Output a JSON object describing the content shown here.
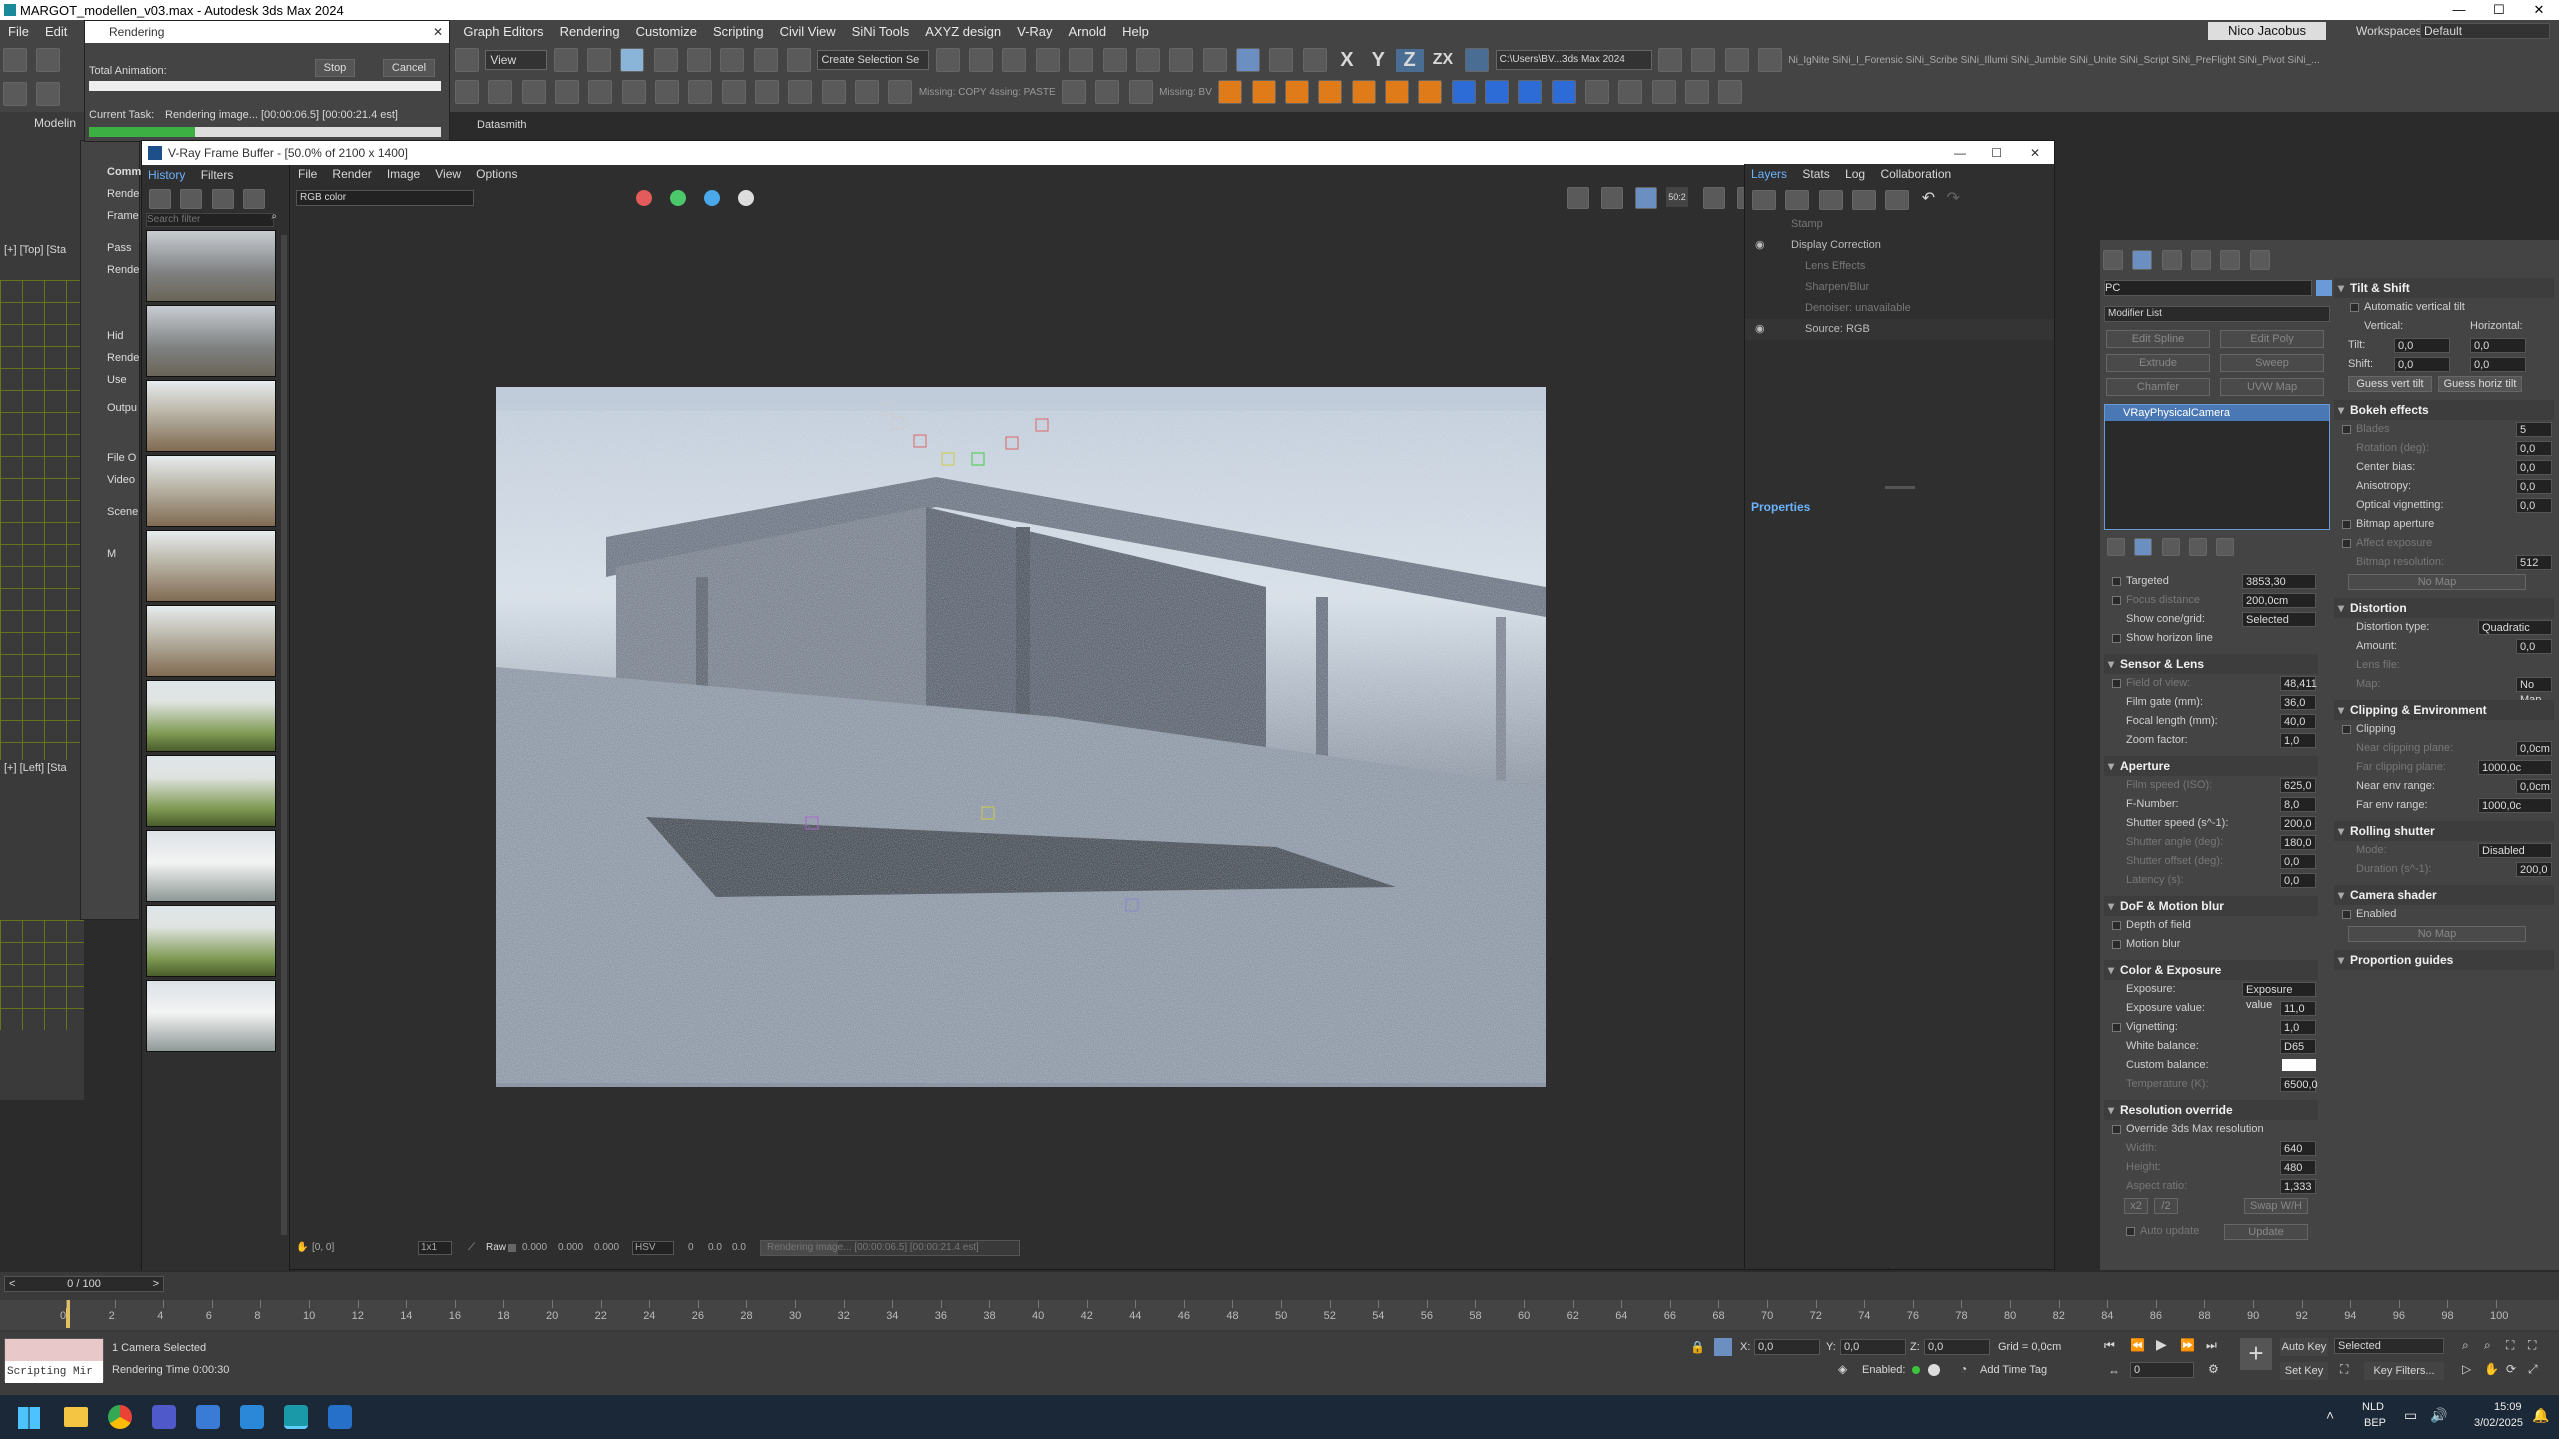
{
  "window": {
    "title": "MARGOT_modellen_v03.max - Autodesk 3ds Max 2024"
  },
  "menu": [
    "File",
    "Edit",
    "Graph Editors",
    "Rendering",
    "Customize",
    "Scripting",
    "Civil View",
    "SiNi Tools",
    "AXYZ design",
    "V-Ray",
    "Arnold",
    "Help"
  ],
  "user": "Nico Jacobus",
  "workspace": {
    "label": "Workspaces:",
    "value": "Default"
  },
  "toolbar": {
    "view_dropdown": "View",
    "create_selection": "Create Selection Se",
    "path": "C:\\Users\\BV...3ds Max 2024",
    "missing_text": "Missing: COPY 4ssing: PASTE",
    "missing_bv": "Missing: BV",
    "sini_items": "Ni_IgNite  SiNi_I_Forensic  SiNi_Scribe  SiNi_Illumi  SiNi_Jumble  SiNi_Unite  SiNi_Script  SiNi_PreFlight  SiNi_Pivot  SiNi_..."
  },
  "rendering_dialog": {
    "title": "Rendering",
    "total_animation": "Total Animation:",
    "stop": "Stop",
    "cancel": "Cancel",
    "current_task_label": "Current Task:",
    "current_task": "Rendering image... [00:00:06.5] [00:00:21.4 est]",
    "datasmith": "Datasmith"
  },
  "viewport_labels": {
    "top": "[+] [Top] [Sta",
    "left": "[+] [Left] [Sta"
  },
  "behind_labels": [
    "Comm",
    "Rende",
    "Frame",
    "Pass",
    "Rende",
    "Hid",
    "Rende",
    "Use",
    "Outpu",
    "File O",
    "Video",
    "Scene",
    "M",
    "Modelin"
  ],
  "vfb": {
    "title": "V-Ray Frame Buffer - [50.0% of 2100 x 1400]",
    "left_tabs": [
      "History",
      "Filters"
    ],
    "menus": [
      "File",
      "Render",
      "Image",
      "View",
      "Options"
    ],
    "search_placeholder": "Search filter",
    "channel": "RGB color",
    "zoom_badge": "50:2",
    "right_tabs": [
      "Layers",
      "Stats",
      "Log",
      "Collaboration"
    ],
    "layers": [
      "Stamp",
      "Display Correction",
      "Lens Effects",
      "Sharpen/Blur",
      "Denoiser: unavailable",
      "Source: RGB"
    ],
    "properties": "Properties",
    "status": {
      "coords": "[0, 0]",
      "ratio": "1x1",
      "raw": "Raw",
      "r": "0.000",
      "g": "0.000",
      "b": "0.000",
      "mode": "HSV",
      "h": "0",
      "s": "0.0",
      "v": "0.0",
      "progress": "Rendering image... [00:00:06.5] [00:00:21.4 est]",
      "progress_fraction": 0.3
    }
  },
  "cmd_panel": {
    "object_name": "PC",
    "modifier_list": "Modifier List",
    "buttons": [
      "Edit Spline",
      "Edit Poly",
      "Extrude",
      "Sweep",
      "Chamfer",
      "UVW Map"
    ],
    "stack_item": "VRayPhysicalCamera"
  },
  "cam_left": {
    "top_rows": [
      {
        "label": "Targeted",
        "value": "3853,30",
        "check": true
      },
      {
        "label": "Focus distance",
        "value": "200,0cm",
        "check": true,
        "dis": true
      },
      {
        "label": "Show cone/grid:",
        "value": "Selected",
        "check": false
      },
      {
        "label": "Show horizon line",
        "value": "",
        "check": true
      }
    ],
    "sensor": {
      "title": "Sensor & Lens",
      "rows": [
        {
          "label": "Field of view:",
          "value": "48,411",
          "check": true,
          "dis": true
        },
        {
          "label": "Film gate (mm):",
          "value": "36,0"
        },
        {
          "label": "Focal length (mm):",
          "value": "40,0"
        },
        {
          "label": "Zoom factor:",
          "value": "1,0"
        }
      ]
    },
    "aperture": {
      "title": "Aperture",
      "rows": [
        {
          "label": "Film speed (ISO):",
          "value": "625,0",
          "dis": true
        },
        {
          "label": "F-Number:",
          "value": "8,0"
        },
        {
          "label": "Shutter speed (s^-1):",
          "value": "200,0"
        },
        {
          "label": "Shutter angle (deg):",
          "value": "180,0",
          "dis": true
        },
        {
          "label": "Shutter offset (deg):",
          "value": "0,0",
          "dis": true
        },
        {
          "label": "Latency (s):",
          "value": "0,0",
          "dis": true
        }
      ]
    },
    "dof": {
      "title": "DoF & Motion blur",
      "rows": [
        {
          "label": "Depth of field",
          "value": "",
          "check": true
        },
        {
          "label": "Motion blur",
          "value": "",
          "check": true
        }
      ]
    },
    "color": {
      "title": "Color & Exposure",
      "rows": [
        {
          "label": "Exposure:",
          "value": "Exposure value"
        },
        {
          "label": "Exposure value:",
          "value": "11,0"
        },
        {
          "label": "Vignetting:",
          "value": "1,0",
          "check": true
        },
        {
          "label": "White balance:",
          "value": "D65"
        },
        {
          "label": "Custom balance:",
          "value": ""
        },
        {
          "label": "Temperature (K):",
          "value": "6500,0",
          "dis": true
        }
      ]
    },
    "resolution": {
      "title": "Resolution override",
      "rows": [
        {
          "label": "Override 3ds Max resolution",
          "value": "",
          "check": true
        },
        {
          "label": "Width:",
          "value": "640",
          "dis": true
        },
        {
          "label": "Height:",
          "value": "480",
          "dis": true
        },
        {
          "label": "Aspect ratio:",
          "value": "1,333",
          "dis": true
        }
      ],
      "buttons": [
        "x2",
        "/2",
        "Swap W/H"
      ],
      "auto_update": "Auto update",
      "update": "Update"
    }
  },
  "cam_right": {
    "tilt": {
      "title": "Tilt & Shift",
      "auto": "Automatic vertical tilt",
      "vertical": "Vertical:",
      "horizontal": "Horizontal:",
      "tilt_label": "Tilt:",
      "tilt_v": "0,0",
      "tilt_h": "0,0",
      "shift_label": "Shift:",
      "shift_v": "0,0",
      "shift_h": "0,0",
      "guess_vert": "Guess vert tilt",
      "guess_horiz": "Guess horiz tilt"
    },
    "bokeh": {
      "title": "Bokeh effects",
      "rows": [
        {
          "label": "Blades",
          "value": "5",
          "check": true,
          "dis": true
        },
        {
          "label": "Rotation (deg):",
          "value": "0,0",
          "dis": true
        },
        {
          "label": "Center bias:",
          "value": "0,0"
        },
        {
          "label": "Anisotropy:",
          "value": "0,0"
        },
        {
          "label": "Optical vignetting:",
          "value": "0,0"
        },
        {
          "label": "Bitmap aperture",
          "value": "",
          "check": true
        },
        {
          "label": "Affect exposure",
          "value": "",
          "check": true,
          "dis": true
        },
        {
          "label": "Bitmap resolution:",
          "value": "512",
          "dis": true
        }
      ],
      "no_map": "No Map"
    },
    "distortion": {
      "title": "Distortion",
      "rows": [
        {
          "label": "Distortion type:",
          "value": "Quadratic"
        },
        {
          "label": "Amount:",
          "value": "0,0"
        },
        {
          "label": "Lens file:",
          "value": "",
          "dis": true
        },
        {
          "label": "Map:",
          "value": "No Map",
          "dis": true
        }
      ]
    },
    "clipping": {
      "title": "Clipping & Environment",
      "rows": [
        {
          "label": "Clipping",
          "value": "",
          "check": true
        },
        {
          "label": "Near clipping plane:",
          "value": "0,0cm",
          "dis": true
        },
        {
          "label": "Far clipping plane:",
          "value": "1000,0c",
          "dis": true
        },
        {
          "label": "Near env range:",
          "value": "0,0cm"
        },
        {
          "label": "Far env range:",
          "value": "1000,0c"
        }
      ]
    },
    "rolling": {
      "title": "Rolling shutter",
      "rows": [
        {
          "label": "Mode:",
          "value": "Disabled",
          "dis": true
        },
        {
          "label": "Duration (s^-1):",
          "value": "200,0",
          "dis": true
        }
      ]
    },
    "shader": {
      "title": "Camera shader",
      "rows": [
        {
          "label": "Enabled",
          "value": "",
          "check": true
        }
      ],
      "no_map": "No Map"
    },
    "guides": {
      "title": "Proportion guides"
    }
  },
  "timeline": {
    "frame": "0 / 100",
    "ticks": [
      "0",
      "2",
      "4",
      "6",
      "8",
      "10",
      "12",
      "14",
      "16",
      "18",
      "20",
      "22",
      "24",
      "26",
      "28",
      "30",
      "32",
      "34",
      "36",
      "38",
      "40",
      "42",
      "44",
      "46",
      "48",
      "50",
      "52",
      "54",
      "56",
      "58",
      "60",
      "62",
      "64",
      "66",
      "68",
      "70",
      "72",
      "74",
      "76",
      "78",
      "80",
      "82",
      "84",
      "86",
      "88",
      "90",
      "92",
      "94",
      "96",
      "98",
      "100"
    ]
  },
  "statusbar": {
    "selected": "1 Camera Selected",
    "render_time": "Rendering Time  0:00:30",
    "maxscript": "Scripting Mir",
    "x_label": "X:",
    "x": "0,0",
    "y_label": "Y:",
    "y": "0,0",
    "z_label": "Z:",
    "z": "0,0",
    "grid": "Grid = 0,0cm",
    "enabled": "Enabled:",
    "add_time_tag": "Add Time Tag",
    "auto_key": "Auto Key",
    "set_key": "Set Key",
    "key_mode": "Selected",
    "key_filters": "Key Filters...",
    "frame_field": "0"
  },
  "taskbar": {
    "lang1": "NLD",
    "lang2": "BEP",
    "time": "15:09",
    "date": "3/02/2025"
  }
}
